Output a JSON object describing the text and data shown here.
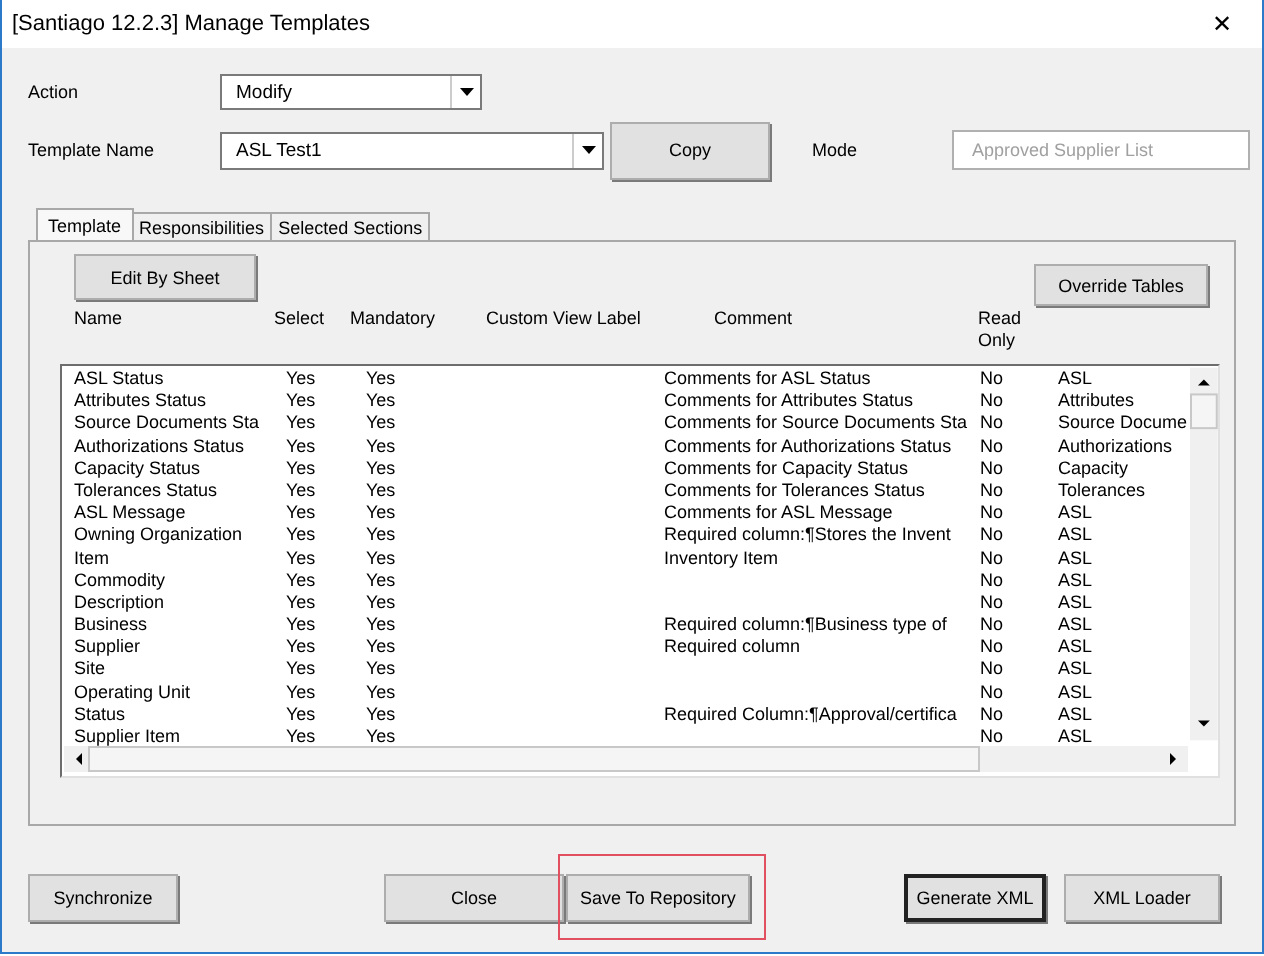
{
  "window": {
    "title": "[Santiago 12.2.3] Manage Templates",
    "close": "✕"
  },
  "action": {
    "label": "Action",
    "value": "Modify"
  },
  "template_name": {
    "label": "Template Name",
    "value": "ASL Test1"
  },
  "copy_button": "Copy",
  "mode": {
    "label": "Mode",
    "value": "Approved Supplier List",
    "disabled": true
  },
  "tabs": [
    {
      "label": "Template",
      "selected": true
    },
    {
      "label": "Responsibilities",
      "selected": false
    },
    {
      "label": "Selected Sections",
      "selected": false
    }
  ],
  "edit_by_sheet_button": "Edit By Sheet",
  "override_tables_button": "Override Tables",
  "table": {
    "columns": [
      "Name",
      "Select",
      "Mandatory",
      "Custom View Label",
      "Comment",
      "Read Only"
    ],
    "rows": [
      {
        "name": "ASL Status",
        "select": "Yes",
        "mandatory": "Yes",
        "comment": "Comments for ASL Status",
        "read_only": "No",
        "column_7": "ASL"
      },
      {
        "name": "Attributes Status",
        "select": "Yes",
        "mandatory": "Yes",
        "comment": "Comments for Attributes Status",
        "read_only": "No",
        "column_7": "Attributes"
      },
      {
        "name": "Source Documents Sta",
        "select": "Yes",
        "mandatory": "Yes",
        "comment": "Comments for Source Documents Sta",
        "read_only": "No",
        "column_7": "Source Docume"
      },
      {
        "name": "Authorizations Status",
        "select": "Yes",
        "mandatory": "Yes",
        "comment": "Comments for Authorizations Status",
        "read_only": "No",
        "column_7": "Authorizations"
      },
      {
        "name": "Capacity Status",
        "select": "Yes",
        "mandatory": "Yes",
        "comment": "Comments for Capacity Status",
        "read_only": "No",
        "column_7": "Capacity"
      },
      {
        "name": "Tolerances Status",
        "select": "Yes",
        "mandatory": "Yes",
        "comment": "Comments for Tolerances Status",
        "read_only": "No",
        "column_7": "Tolerances"
      },
      {
        "name": "ASL Message",
        "select": "Yes",
        "mandatory": "Yes",
        "comment": "Comments for ASL Message",
        "read_only": "No",
        "column_7": "ASL"
      },
      {
        "name": "Owning Organization",
        "select": "Yes",
        "mandatory": "Yes",
        "comment": "Required column:¶Stores the Invent",
        "read_only": "No",
        "column_7": "ASL"
      },
      {
        "name": "Item",
        "select": "Yes",
        "mandatory": "Yes",
        "comment": "Inventory Item",
        "read_only": "No",
        "column_7": "ASL"
      },
      {
        "name": "Commodity",
        "select": "Yes",
        "mandatory": "Yes",
        "read_only": "No",
        "column_7": "ASL"
      },
      {
        "name": "Description",
        "select": "Yes",
        "mandatory": "Yes",
        "read_only": "No",
        "column_7": "ASL"
      },
      {
        "name": "Business",
        "select": "Yes",
        "mandatory": "Yes",
        "comment": "Required column:¶Business type of",
        "read_only": "No",
        "column_7": "ASL"
      },
      {
        "name": "Supplier",
        "select": "Yes",
        "mandatory": "Yes",
        "comment": "Required column",
        "read_only": "No",
        "column_7": "ASL"
      },
      {
        "name": "Site",
        "select": "Yes",
        "mandatory": "Yes",
        "read_only": "No",
        "column_7": "ASL"
      },
      {
        "name": "Operating Unit",
        "select": "Yes",
        "mandatory": "Yes",
        "read_only": "No",
        "column_7": "ASL"
      },
      {
        "name": "Status",
        "select": "Yes",
        "mandatory": "Yes",
        "comment": "Required Column:¶Approval/certifica",
        "read_only": "No",
        "column_7": "ASL"
      },
      {
        "name": "Supplier Item",
        "select": "Yes",
        "mandatory": "Yes",
        "read_only": "No",
        "column_7": "ASL"
      }
    ]
  },
  "buttons": [
    {
      "label": "Synchronize",
      "default": false,
      "highlighted": false
    },
    {
      "label": "Close",
      "default": false,
      "highlighted": false
    },
    {
      "label": "Save To Repository",
      "default": false,
      "highlighted": true
    },
    {
      "label": "Generate XML",
      "default": true,
      "highlighted": false
    },
    {
      "label": "XML Loader",
      "default": false,
      "highlighted": false
    }
  ]
}
